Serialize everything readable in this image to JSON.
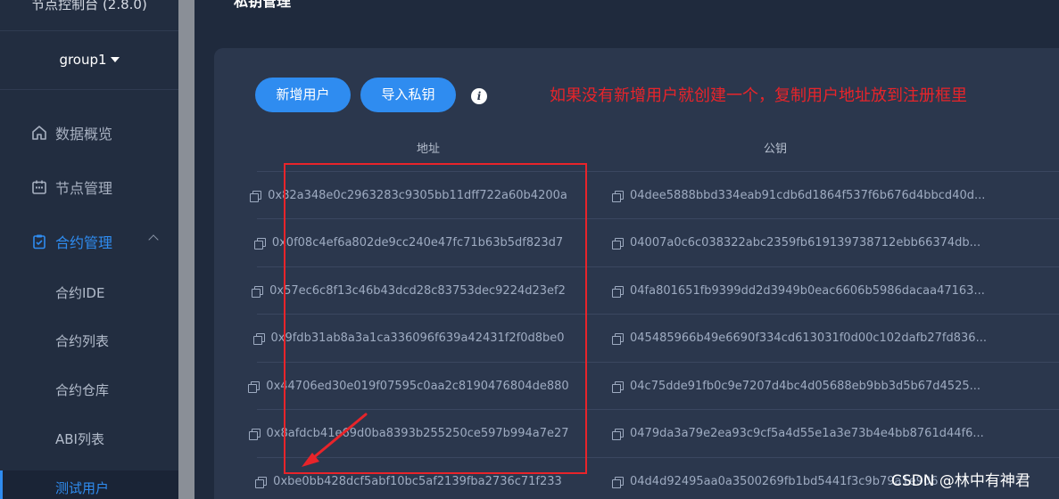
{
  "sidebar": {
    "app_title": "节点控制台 (2.8.0)",
    "group": "group1",
    "nav": [
      {
        "label": "数据概览",
        "icon": "home-icon"
      },
      {
        "label": "节点管理",
        "icon": "calendar-icon"
      },
      {
        "label": "合约管理",
        "icon": "clipboard-icon"
      }
    ],
    "sub_items": [
      "合约IDE",
      "合约列表",
      "合约仓库",
      "ABI列表",
      "测试用户"
    ]
  },
  "page": {
    "title": "私钥管理"
  },
  "toolbar": {
    "add_user": "新增用户",
    "import_key": "导入私钥",
    "info": "i"
  },
  "annotation": "如果没有新增用户就创建一个，复制用户地址放到注册框里",
  "table": {
    "headers": {
      "address": "地址",
      "public_key": "公钥"
    },
    "rows": [
      {
        "address": "0x82a348e0c2963283c9305bb11dff722a60b4200a",
        "public_key": "04dee5888bbd334eab91cdb6d1864f537f6b676d4bbcd40d..."
      },
      {
        "address": "0x0f08c4ef6a802de9cc240e47fc71b63b5df823d7",
        "public_key": "04007a0c6c038322abc2359fb619139738712ebb66374db..."
      },
      {
        "address": "0x57ec6c8f13c46b43dcd28c83753dec9224d23ef2",
        "public_key": "04fa801651fb9399dd2d3949b0eac6606b5986dacaa47163..."
      },
      {
        "address": "0x9fdb31ab8a3a1ca336096f639a42431f2f0d8be0",
        "public_key": "045485966b49e6690f334cd613031f0d00c102dafb27fd836..."
      },
      {
        "address": "0x44706ed30e019f07595c0aa2c8190476804de880",
        "public_key": "04c75dde91fb0c9e7207d4bc4d05688eb9bb3d5b67d4525..."
      },
      {
        "address": "0x8afdcb41e69d0ba8393b255250ce597b994a7e27",
        "public_key": "0479da3a79e2ea93c9cf5a4d55e1a3e73b4e4bb8761d44f6..."
      },
      {
        "address": "0xbe0bb428dcf5abf10bc5af2139fba2736c71f233",
        "public_key": "04d4d92495aa0a3500269fb1bd5441f3c9b79a1e906"
      }
    ]
  },
  "watermark": "CSDN @林中有神君",
  "colors": {
    "accent": "#2f8cf0",
    "annotation": "#e8242a",
    "card": "#2b374d",
    "sidebar": "#222d40"
  }
}
